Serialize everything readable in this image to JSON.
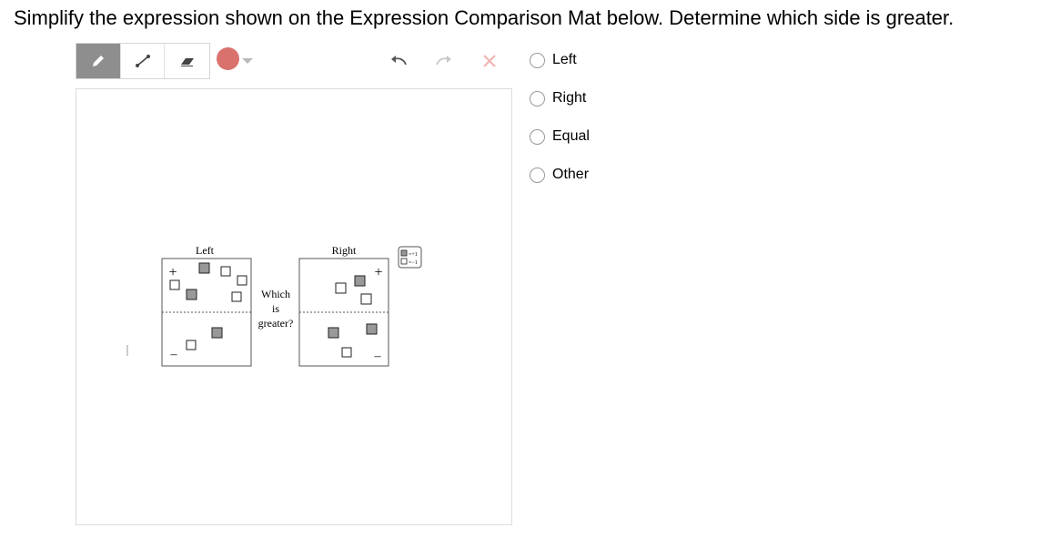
{
  "question": "Simplify the expression shown on the Expression Comparison Mat below. Determine which side is greater.",
  "toolbar": {
    "tools": [
      "pencil-icon",
      "line-icon",
      "eraser-icon"
    ],
    "active_tool": "pencil-icon",
    "color": "#d9726d"
  },
  "mat": {
    "left_label": "Left",
    "right_label": "Right",
    "middle_line1": "Which",
    "middle_line2": "is",
    "middle_line3": "greater?",
    "plus": "+",
    "minus": "–",
    "key_positive": "=+1",
    "key_negative": "=−1"
  },
  "choices": [
    {
      "label": "Left"
    },
    {
      "label": "Right"
    },
    {
      "label": "Equal"
    },
    {
      "label": "Other"
    }
  ]
}
